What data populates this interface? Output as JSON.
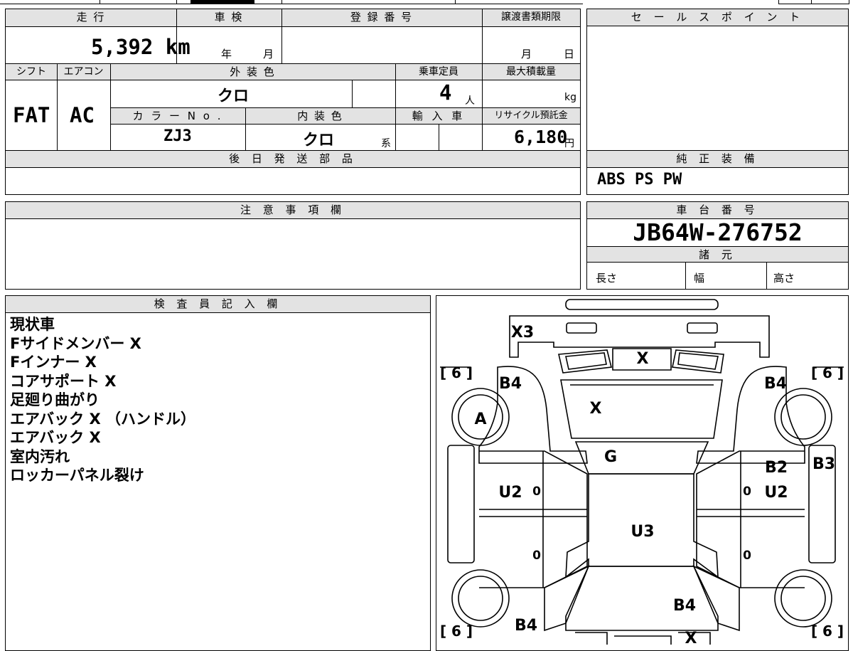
{
  "top_info": {
    "labels": {
      "mileage": "走 行",
      "inspection": "車 検",
      "registration": "登 録 番 号",
      "transfer_deadline": "譲渡書類期限",
      "shift": "シフト",
      "aircon": "エアコン",
      "exterior_color": "外 装 色",
      "capacity": "乗車定員",
      "max_load": "最大積載量",
      "color_no": "カ ラ ー N o .",
      "interior_color": "内 装 色",
      "import": "輸 入 車",
      "recycle_fee": "リサイクル預託金",
      "year_suffix": "年",
      "month_suffix": "月",
      "deadline_month": "月",
      "deadline_day": "日",
      "persons_unit": "人",
      "kg_unit": "kg",
      "interior_suffix": "系",
      "yen_unit": "円"
    },
    "values": {
      "mileage": "5,392 km",
      "shift": "FAT",
      "aircon": "AC",
      "exterior_color": "クロ",
      "capacity": "4",
      "color_no": "ZJ3",
      "interior_color": "クロ",
      "recycle_fee": "6,180"
    }
  },
  "later_parts": {
    "label": "後 日 発 送 部 品"
  },
  "sales_point": {
    "label": "セ ー ル ス ポ イ ン ト"
  },
  "genuine_equipment": {
    "label": "純 正 装 備",
    "value": "ABS PS PW"
  },
  "notes": {
    "label": "注 意 事 項 欄"
  },
  "chassis": {
    "label": "車 台 番 号",
    "value": "JB64W-276752",
    "specs_label": "諸 元",
    "length": "長さ",
    "width": "幅",
    "height": "高さ"
  },
  "inspector": {
    "label": "検 査 員 記 入 欄",
    "lines": [
      "現状車",
      "Fサイドメンバー X",
      "Fインナー X",
      "コアサポート X",
      "足廻り曲がり",
      "エアバック X （ハンドル）",
      "エアバック X",
      "室内汚れ",
      "ロッカーパネル裂け"
    ]
  },
  "car_map": {
    "marks": {
      "front_bumper": "X3",
      "front_panel": "X",
      "hood": "X",
      "left_front": "B4",
      "right_front": "B4",
      "left_wheel": "A",
      "windshield": "G",
      "right_door_front": "B2",
      "right_rocker": "B3",
      "left_door": "U2",
      "right_door": "U2",
      "roof": "U3",
      "rear": "B4",
      "left_rear": "B4",
      "rear_bottom": "X"
    },
    "tires": {
      "front_left": "[ 6 ]",
      "front_right": "[ 6 ]",
      "rear_left": "[ 6 ]",
      "rear_right": "[ 6 ]"
    },
    "zeros": [
      "0",
      "0",
      "0",
      "0"
    ]
  }
}
